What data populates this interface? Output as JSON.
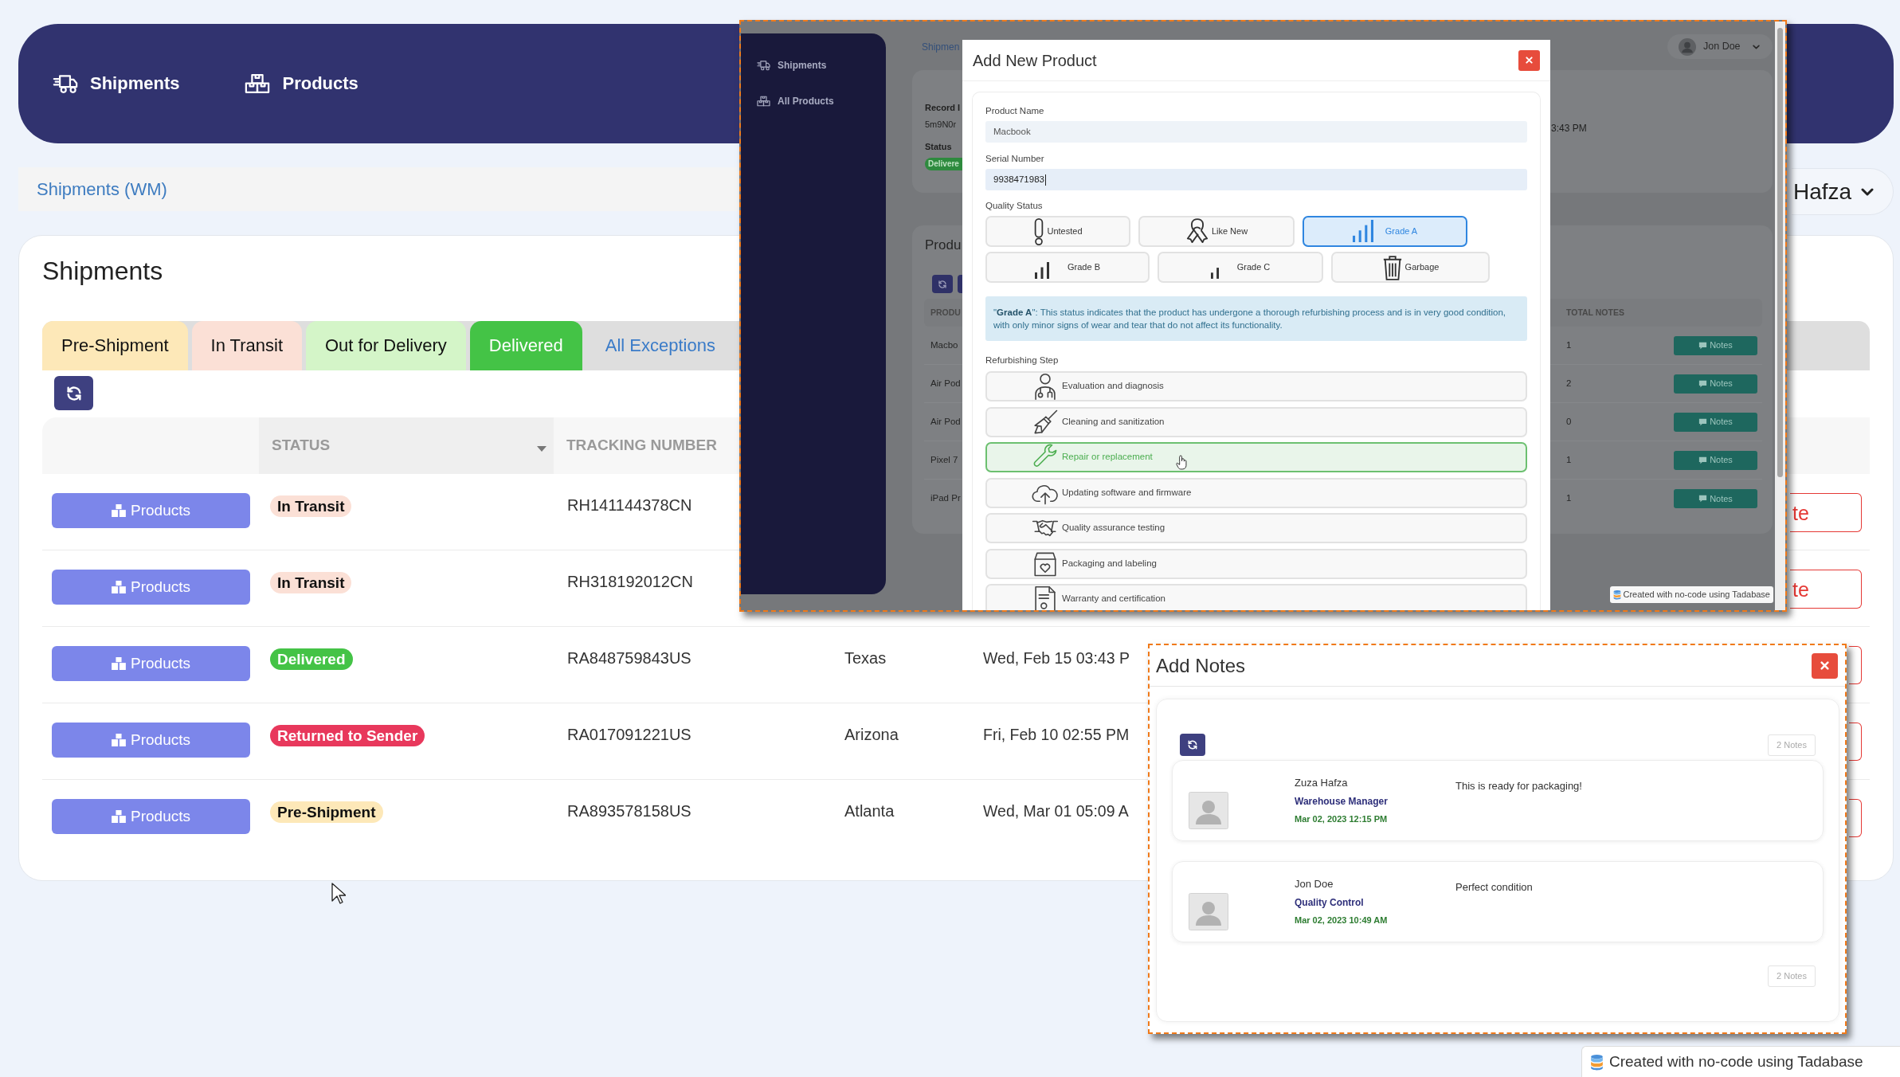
{
  "nav": {
    "items": [
      {
        "label": "Shipments"
      },
      {
        "label": "Products"
      }
    ]
  },
  "breadcrumb": {
    "label": "Shipments (WM)"
  },
  "user_menu": {
    "name": "Hafza"
  },
  "shipments_card": {
    "title": "Shipments",
    "tabs": [
      {
        "label": "Pre-Shipment",
        "selected": false,
        "color": "#fde8b8"
      },
      {
        "label": "In Transit",
        "selected": false,
        "color": "#fbe0d6"
      },
      {
        "label": "Out for Delivery",
        "selected": false,
        "color": "#d4f5c8"
      },
      {
        "label": "Delivered",
        "selected": true,
        "color": "#44c346"
      },
      {
        "label": "All Exceptions",
        "selected": false
      }
    ],
    "table": {
      "columns": [
        {
          "label": "STATUS",
          "sorted": true
        },
        {
          "label": "TRACKING NUMBER"
        }
      ],
      "rows": [
        {
          "button": "Products",
          "status": {
            "label": "In Transit",
            "color": "#fbe0d6"
          },
          "tracking_number": "RH141144378CN",
          "column_6": "te"
        },
        {
          "button": "Products",
          "status": {
            "label": "In Transit",
            "color": "#fbe0d6"
          },
          "tracking_number": "RH318192012CN",
          "column_6": "te"
        },
        {
          "button": "Products",
          "status": {
            "label": "Delivered",
            "color": "#44c346"
          },
          "tracking_number": "RA848759843US",
          "column_4": "Texas",
          "column_5": "Wed, Feb 15 03:43 P"
        },
        {
          "button": "Products",
          "status": {
            "label": "Returned to Sender",
            "color": "#e8385c"
          },
          "tracking_number": "RA017091221US",
          "column_4": "Arizona",
          "column_5": "Fri, Feb 10 02:55 PM"
        },
        {
          "button": "Products",
          "status": {
            "label": "Pre-Shipment",
            "color": "#fde8b8"
          },
          "tracking_number": "RA893578158US",
          "column_4": "Atlanta",
          "column_5": "Wed, Mar 01 05:09 A"
        }
      ]
    }
  },
  "product_screenshot": {
    "sidebar": {
      "items": [
        {
          "label": "Shipments"
        },
        {
          "label": "All Products"
        }
      ]
    },
    "breadcrumb": "Shipmen",
    "user_menu": {
      "name": "Jon Doe"
    },
    "record_card": {
      "label": "Record I",
      "value": "5m9N0r",
      "status_label": "Status",
      "status": "Delivere",
      "time": "3:43 PM"
    },
    "products_card": {
      "title": "Produ",
      "columns": [
        {
          "label": "PRODU"
        },
        {
          "label": "TOTAL NOTES"
        }
      ],
      "rows": [
        {
          "column_1": "Macbo",
          "total_notes": "1",
          "notes_button": "Notes"
        },
        {
          "column_1": "Air Pod",
          "total_notes": "2",
          "notes_button": "Notes"
        },
        {
          "column_1": "Air Pod",
          "total_notes": "0",
          "notes_button": "Notes"
        },
        {
          "column_1": "Pixel 7",
          "total_notes": "1",
          "notes_button": "Notes"
        },
        {
          "column_1": "iPad Pr",
          "total_notes": "1",
          "notes_button": "Notes"
        }
      ]
    },
    "modal": {
      "title": "Add New Product",
      "fields": [
        {
          "label": "Product Name",
          "value": "Macbook",
          "focused": false
        },
        {
          "label": "Serial Number",
          "value": "9938471983",
          "focused": true
        }
      ],
      "quality_status": {
        "label": "Quality Status",
        "options": [
          {
            "label": "Untested",
            "selected": false
          },
          {
            "label": "Like New",
            "selected": false
          },
          {
            "label": "Grade A",
            "selected": true
          },
          {
            "label": "Grade B",
            "selected": false
          },
          {
            "label": "Grade C",
            "selected": false
          },
          {
            "label": "Garbage",
            "selected": false
          }
        ]
      },
      "info": "\"**Grade A**\": This status indicates that the product has undergone a thorough refurbishing process and is in very good condition, with only minor signs of wear and tear that do not affect its functionality.",
      "refurbishing_step": {
        "label": "Refurbishing Step",
        "options": [
          {
            "label": "Evaluation and diagnosis",
            "selected": false
          },
          {
            "label": "Cleaning and sanitization",
            "selected": false
          },
          {
            "label": "Repair or replacement",
            "selected": true
          },
          {
            "label": "Updating software and firmware",
            "selected": false
          },
          {
            "label": "Quality assurance testing",
            "selected": false
          },
          {
            "label": "Packaging and labeling",
            "selected": false
          },
          {
            "label": "Warranty and certification",
            "selected": false
          }
        ]
      }
    },
    "badge": "Created with no-code using Tadabase"
  },
  "notes_screenshot": {
    "title": "Add Notes",
    "count_top": "2 Notes",
    "notes": [
      {
        "author": "Zuza Hafza",
        "role": "Warehouse Manager",
        "date": "Mar 02, 2023 12:15 PM",
        "message": "This is ready for packaging!"
      },
      {
        "author": "Jon Doe",
        "role": "Quality Control",
        "date": "Mar 02, 2023 10:49 AM",
        "message": "Perfect condition"
      }
    ],
    "count_bottom": "2 Notes"
  },
  "badge": "Created with no-code using Tadabase"
}
